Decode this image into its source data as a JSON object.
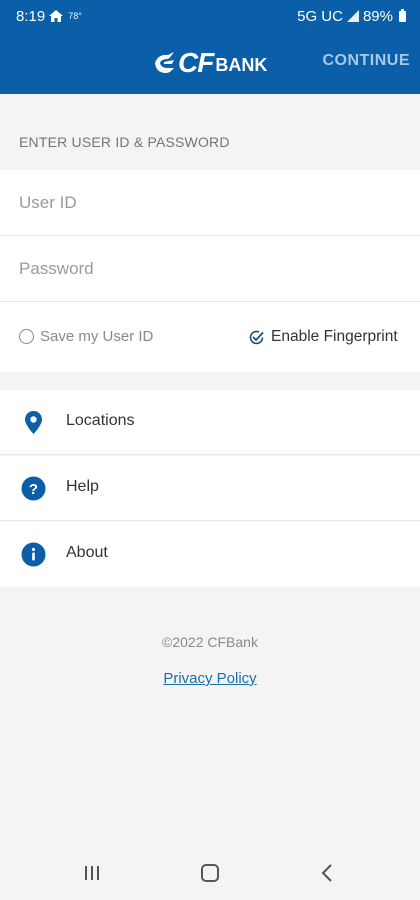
{
  "status_bar": {
    "time": "8:19",
    "temperature": "78°",
    "network": "5G UC",
    "battery": "89%"
  },
  "app_bar": {
    "logo_cf": "CF",
    "logo_bank": "BANK",
    "continue_label": "CONTINUE",
    "background_color": "#0a5fa8"
  },
  "login": {
    "section_title": "ENTER USER ID & PASSWORD",
    "user_id_placeholder": "User ID",
    "password_placeholder": "Password",
    "save_user_id_label": "Save my User ID",
    "save_user_id_checked": false,
    "enable_fingerprint_label": "Enable Fingerprint",
    "enable_fingerprint_checked": true
  },
  "menu": {
    "items": [
      {
        "label": "Locations",
        "icon": "location-pin-icon"
      },
      {
        "label": "Help",
        "icon": "help-icon"
      },
      {
        "label": "About",
        "icon": "info-icon"
      }
    ]
  },
  "footer": {
    "copyright": "©2022 CFBank",
    "privacy_link": "Privacy Policy"
  },
  "navigation_bar": {
    "buttons": [
      "recent-apps-icon",
      "home-icon",
      "back-icon"
    ]
  }
}
